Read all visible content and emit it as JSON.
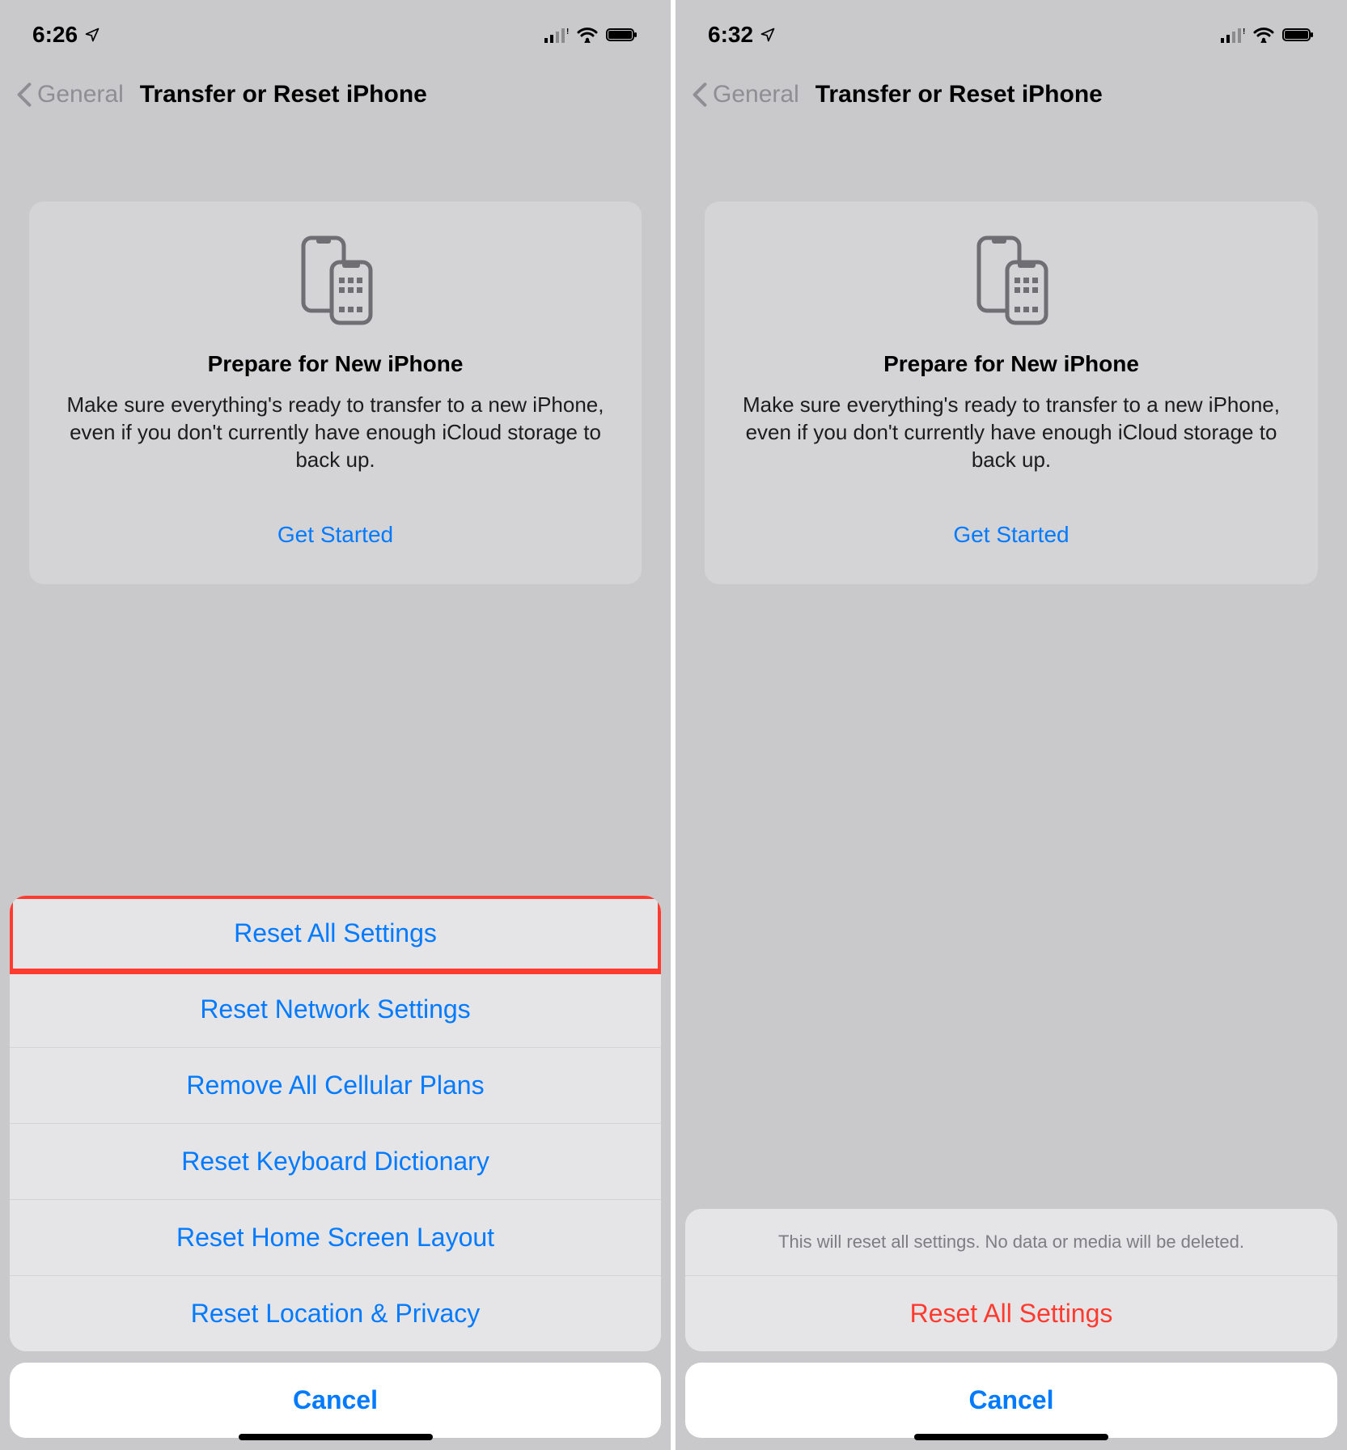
{
  "left": {
    "status": {
      "time": "6:26"
    },
    "nav": {
      "back": "General",
      "title": "Transfer or Reset iPhone"
    },
    "card": {
      "title": "Prepare for New iPhone",
      "desc": "Make sure everything's ready to transfer to a new iPhone, even if you don't currently have enough iCloud storage to back up.",
      "link": "Get Started"
    },
    "sheet": {
      "items": [
        "Reset All Settings",
        "Reset Network Settings",
        "Remove All Cellular Plans",
        "Reset Keyboard Dictionary",
        "Reset Home Screen Layout",
        "Reset Location & Privacy"
      ],
      "cancel": "Cancel"
    }
  },
  "right": {
    "status": {
      "time": "6:32"
    },
    "nav": {
      "back": "General",
      "title": "Transfer or Reset iPhone"
    },
    "card": {
      "title": "Prepare for New iPhone",
      "desc": "Make sure everything's ready to transfer to a new iPhone, even if you don't currently have enough iCloud storage to back up.",
      "link": "Get Started"
    },
    "sheet": {
      "header": "This will reset all settings. No data or media will be deleted.",
      "confirm": "Reset All Settings",
      "cancel": "Cancel"
    }
  },
  "colors": {
    "accent": "#007aff",
    "destructive": "#ff3b30"
  }
}
